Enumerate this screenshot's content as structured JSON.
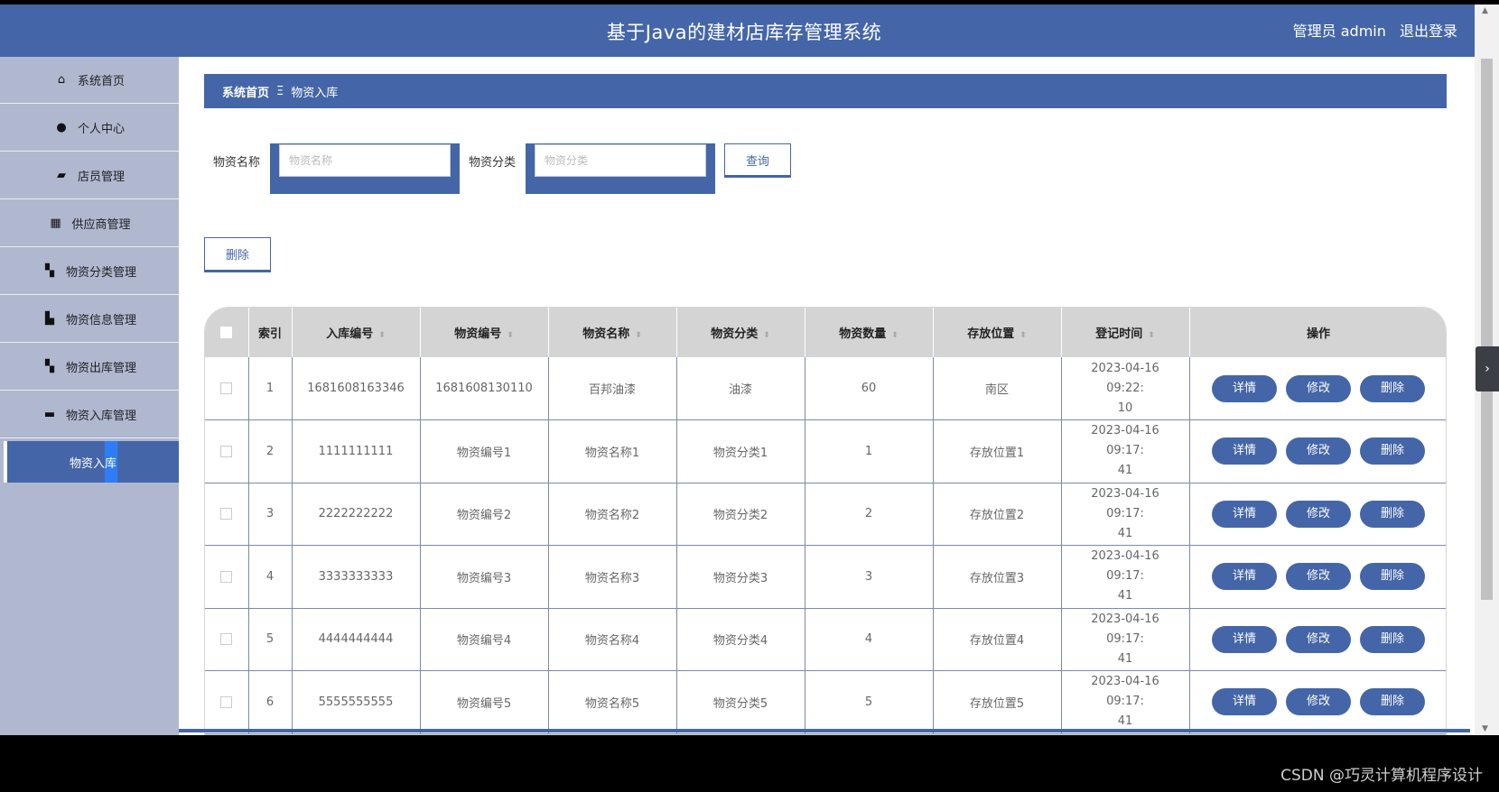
{
  "header": {
    "title": "基于Java的建材店库存管理系统",
    "user": "管理员 admin",
    "logout": "退出登录"
  },
  "sidebar": {
    "items": [
      {
        "label": "系统首页",
        "icon": "home-icon"
      },
      {
        "label": "个人中心",
        "icon": "user-icon"
      },
      {
        "label": "店员管理",
        "icon": "ticket-icon"
      },
      {
        "label": "供应商管理",
        "icon": "grid-icon"
      },
      {
        "label": "物资分类管理",
        "icon": "apps-icon"
      },
      {
        "label": "物资信息管理",
        "icon": "briefcase-icon"
      },
      {
        "label": "物资出库管理",
        "icon": "apps-icon"
      },
      {
        "label": "物资入库管理",
        "icon": "message-icon"
      }
    ],
    "active_sub": "物资入库"
  },
  "breadcrumb": {
    "home": "系统首页",
    "separator": "Ξ",
    "current": "物资入库"
  },
  "search": {
    "name_label": "物资名称",
    "name_placeholder": "物资名称",
    "category_label": "物资分类",
    "category_placeholder": "物资分类",
    "query_button": "查询"
  },
  "actions": {
    "delete_button": "删除"
  },
  "table": {
    "headers": [
      "索引",
      "入库编号",
      "物资编号",
      "物资名称",
      "物资分类",
      "物资数量",
      "存放位置",
      "登记时间",
      "操作"
    ],
    "rows": [
      {
        "index": "1",
        "in_no": "1681608163346",
        "code": "1681608130110",
        "name": "百邦油漆",
        "category": "油漆",
        "qty": "60",
        "location": "南区",
        "time1": "2023-04-16 09:22:",
        "time2": "10"
      },
      {
        "index": "2",
        "in_no": "1111111111",
        "code": "物资编号1",
        "name": "物资名称1",
        "category": "物资分类1",
        "qty": "1",
        "location": "存放位置1",
        "time1": "2023-04-16 09:17:",
        "time2": "41"
      },
      {
        "index": "3",
        "in_no": "2222222222",
        "code": "物资编号2",
        "name": "物资名称2",
        "category": "物资分类2",
        "qty": "2",
        "location": "存放位置2",
        "time1": "2023-04-16 09:17:",
        "time2": "41"
      },
      {
        "index": "4",
        "in_no": "3333333333",
        "code": "物资编号3",
        "name": "物资名称3",
        "category": "物资分类3",
        "qty": "3",
        "location": "存放位置3",
        "time1": "2023-04-16 09:17:",
        "time2": "41"
      },
      {
        "index": "5",
        "in_no": "4444444444",
        "code": "物资编号4",
        "name": "物资名称4",
        "category": "物资分类4",
        "qty": "4",
        "location": "存放位置4",
        "time1": "2023-04-16 09:17:",
        "time2": "41"
      },
      {
        "index": "6",
        "in_no": "5555555555",
        "code": "物资编号5",
        "name": "物资名称5",
        "category": "物资分类5",
        "qty": "5",
        "location": "存放位置5",
        "time1": "2023-04-16 09:17:",
        "time2": "41"
      }
    ],
    "row_actions": {
      "detail": "详情",
      "edit": "修改",
      "delete": "删除"
    }
  },
  "watermark": "CSDN @巧灵计算机程序设计",
  "colors": {
    "primary": "#4466a8",
    "sidebar": "#b0b8cf",
    "header_row": "#d4d4d4",
    "active_marker": "#2f7df6"
  }
}
